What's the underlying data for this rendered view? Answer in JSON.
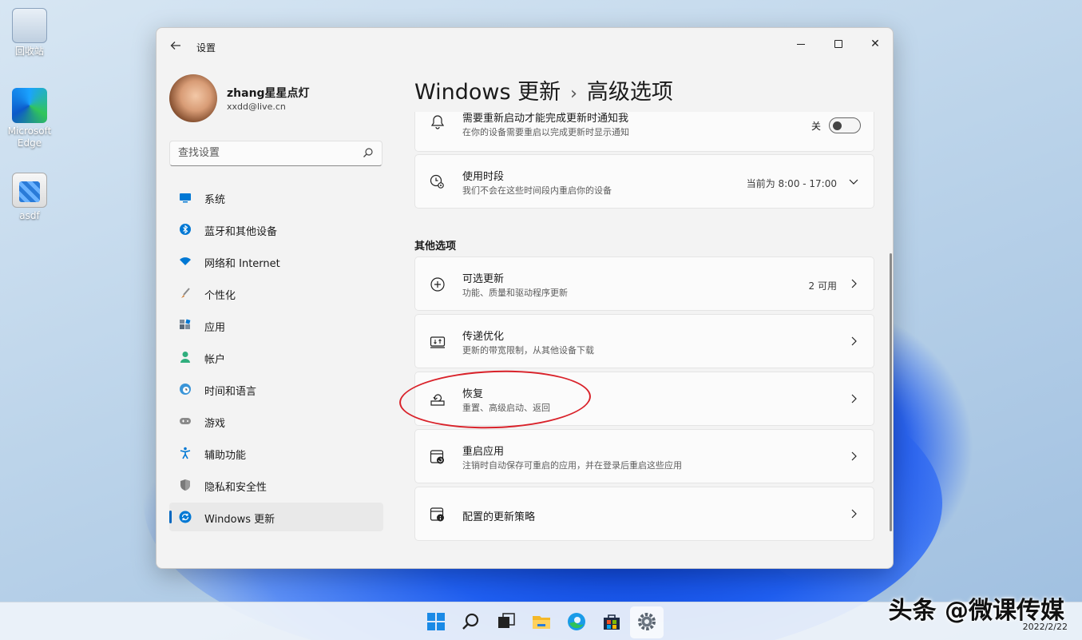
{
  "desktop": {
    "icons": [
      {
        "label": "回收站"
      },
      {
        "label": "Microsoft Edge"
      },
      {
        "label": "asdf"
      }
    ]
  },
  "window": {
    "title": "设置",
    "controls": {
      "minimize": "minimize",
      "maximize": "maximize",
      "close": "✕"
    }
  },
  "profile": {
    "name": "zhang星星点灯",
    "email": "xxdd@live.cn"
  },
  "search": {
    "placeholder": "查找设置"
  },
  "sidebar": {
    "items": [
      {
        "label": "系统",
        "icon": "monitor-icon",
        "color": "#0078d4"
      },
      {
        "label": "蓝牙和其他设备",
        "icon": "bluetooth-icon",
        "color": "#0078d4"
      },
      {
        "label": "网络和 Internet",
        "icon": "wifi-icon",
        "color": "#0078d4"
      },
      {
        "label": "个性化",
        "icon": "brush-icon",
        "color": "#d07a2c"
      },
      {
        "label": "应用",
        "icon": "apps-icon",
        "color": "#5a6b7b"
      },
      {
        "label": "帐户",
        "icon": "person-icon",
        "color": "#2fae7d"
      },
      {
        "label": "时间和语言",
        "icon": "globe-clock-icon",
        "color": "#0078d4"
      },
      {
        "label": "游戏",
        "icon": "gamepad-icon",
        "color": "#7a7a7a"
      },
      {
        "label": "辅助功能",
        "icon": "accessibility-icon",
        "color": "#0078d4"
      },
      {
        "label": "隐私和安全性",
        "icon": "shield-icon",
        "color": "#6b6b6b"
      },
      {
        "label": "Windows 更新",
        "icon": "update-icon",
        "color": "#0078d4",
        "active": true
      }
    ]
  },
  "header": {
    "parent": "Windows 更新",
    "separator": "›",
    "current": "高级选项"
  },
  "cards_top": [
    {
      "title": "需要重新启动才能完成更新时通知我",
      "subtitle": "在你的设备需要重启以完成更新时显示通知",
      "toggle_label": "关",
      "icon": "bell-icon"
    },
    {
      "title": "使用时段",
      "subtitle": "我们不会在这些时间段内重启你的设备",
      "value": "当前为 8:00 - 17:00",
      "icon": "clock-gear-icon"
    }
  ],
  "other_options": {
    "label": "其他选项",
    "cards": [
      {
        "title": "可选更新",
        "subtitle": "功能、质量和驱动程序更新",
        "value": "2 可用",
        "icon": "plus-circle-icon"
      },
      {
        "title": "传递优化",
        "subtitle": "更新的带宽限制，从其他设备下载",
        "value": "",
        "icon": "delivery-icon"
      },
      {
        "title": "恢复",
        "subtitle": "重置、高级启动、返回",
        "value": "",
        "icon": "recovery-icon"
      },
      {
        "title": "重启应用",
        "subtitle": "注销时自动保存可重启的应用，并在登录后重启这些应用",
        "value": "",
        "icon": "restart-apps-icon"
      },
      {
        "title": "配置的更新策略",
        "subtitle": "",
        "value": "",
        "icon": "policy-icon"
      }
    ]
  },
  "taskbar": {
    "date": "2022/2/22"
  },
  "watermark": "头条 @微课传媒",
  "colors": {
    "accent": "#0067c0",
    "highlight_ring": "#d9222a"
  }
}
